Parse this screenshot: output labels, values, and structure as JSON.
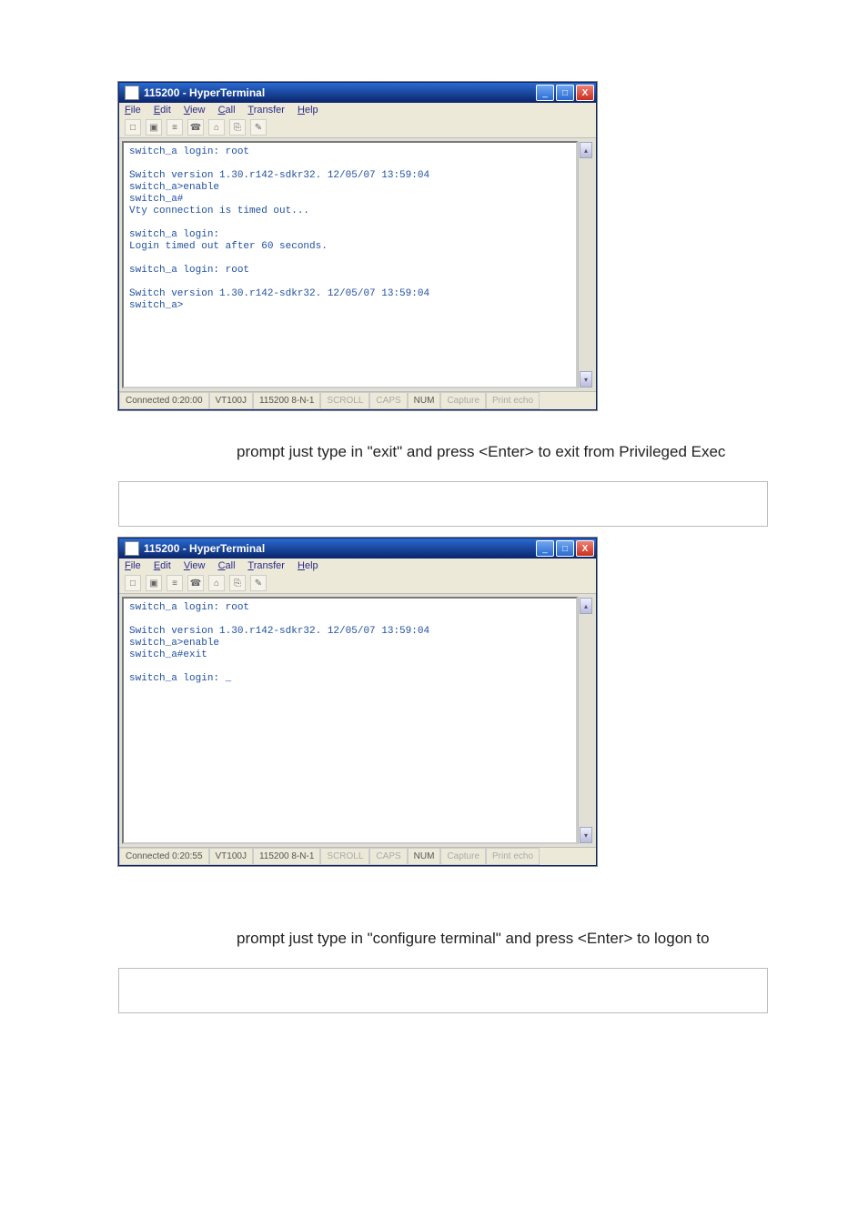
{
  "windows": [
    {
      "title": "115200 - HyperTerminal",
      "menu": [
        "File",
        "Edit",
        "View",
        "Call",
        "Transfer",
        "Help"
      ],
      "terminal_text": "switch_a login: root\n\nSwitch version 1.30.r142-sdkr32. 12/05/07 13:59:04\nswitch_a>enable\nswitch_a#\nVty connection is timed out...\n\nswitch_a login:\nLogin timed out after 60 seconds.\n\nswitch_a login: root\n\nSwitch version 1.30.r142-sdkr32. 12/05/07 13:59:04\nswitch_a>",
      "status": {
        "connected": "Connected 0:20:00",
        "emu": "VT100J",
        "params": "115200 8-N-1",
        "scroll": "SCROLL",
        "caps": "CAPS",
        "num": "NUM",
        "capture": "Capture",
        "printecho": "Print echo"
      }
    },
    {
      "title": "115200 - HyperTerminal",
      "menu": [
        "File",
        "Edit",
        "View",
        "Call",
        "Transfer",
        "Help"
      ],
      "terminal_text": "switch_a login: root\n\nSwitch version 1.30.r142-sdkr32. 12/05/07 13:59:04\nswitch_a>enable\nswitch_a#exit\n\nswitch_a login: _",
      "status": {
        "connected": "Connected 0:20:55",
        "emu": "VT100J",
        "params": "115200 8-N-1",
        "scroll": "SCROLL",
        "caps": "CAPS",
        "num": "NUM",
        "capture": "Capture",
        "printecho": "Print echo"
      }
    }
  ],
  "captions": {
    "after_first": "prompt just type in \"exit\" and press <Enter> to exit from Privileged Exec",
    "after_second": "prompt just type in \"configure terminal\" and press <Enter> to logon to"
  },
  "win_buttons": {
    "min": "_",
    "max": "□",
    "close": "X"
  },
  "toolbar_icons": [
    "□",
    "▣",
    "≡",
    "☎",
    "⌂",
    "⎘",
    "✎"
  ]
}
